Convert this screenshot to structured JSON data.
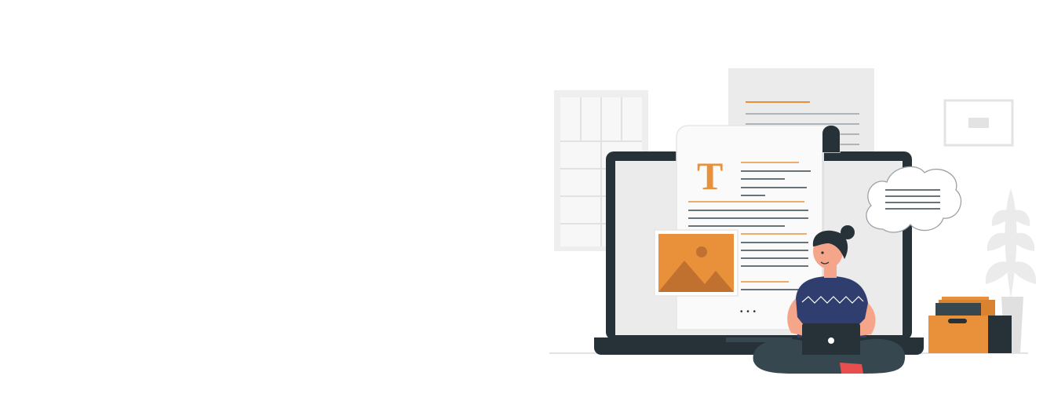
{
  "illustration": {
    "doc_initial": "T",
    "ellipsis": "• • •",
    "colors": {
      "accent": "#E8913A",
      "accent_dark": "#C0712F",
      "dark": "#263238",
      "light_gray": "#EBEBEB",
      "mid_gray": "#DCDCDC",
      "shirt": "#2F3E6E",
      "skin": "#F4A58A",
      "pants": "#37474F"
    }
  }
}
